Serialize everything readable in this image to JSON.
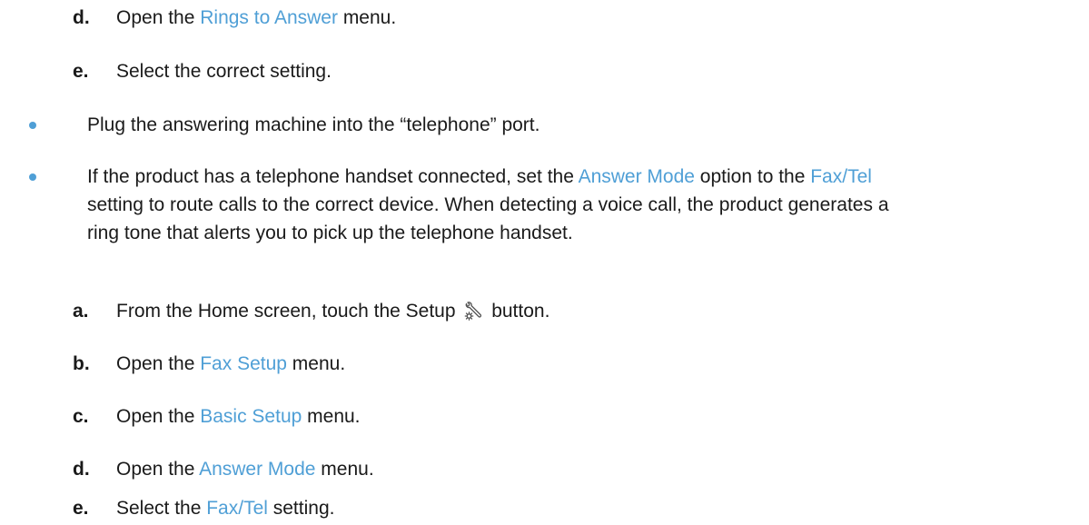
{
  "steps_top": [
    {
      "marker": "d.",
      "pre": "Open the ",
      "link": "Rings to Answer",
      "post": " menu."
    },
    {
      "marker": "e.",
      "text": "Select the correct setting."
    }
  ],
  "bullet1": {
    "text": "Plug the answering machine into the “telephone” port."
  },
  "bullet2": {
    "p1": "If the product has a telephone handset connected, set the ",
    "link1": "Answer Mode",
    "p2": " option to the ",
    "link2": "Fax/Tel",
    "line2": "setting to route calls to the correct device. When detecting a voice call, the product generates a",
    "line3": "ring tone that alerts you to pick up the telephone handset."
  },
  "steps_bottom": [
    {
      "marker": "a.",
      "pre": "From the Home screen, touch the Setup ",
      "post": " button.",
      "icon": "setup-wrench-gear-icon"
    },
    {
      "marker": "b.",
      "pre": "Open the ",
      "link": "Fax Setup",
      "post": " menu."
    },
    {
      "marker": "c.",
      "pre": "Open the ",
      "link": "Basic Setup",
      "post": " menu."
    },
    {
      "marker": "d.",
      "pre": "Open the ",
      "link": "Answer Mode",
      "post": " menu."
    },
    {
      "marker": "e.",
      "pre": "Select the ",
      "link": "Fax/Tel",
      "post": " setting."
    }
  ],
  "colors": {
    "link": "#4f9fd6",
    "bullet": "#4f9fd6",
    "text": "#1a1a1a"
  }
}
